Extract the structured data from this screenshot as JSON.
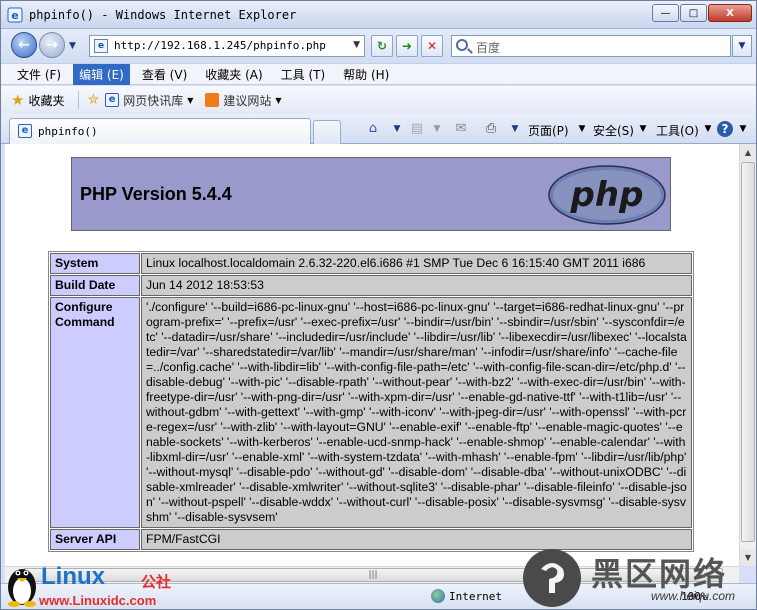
{
  "window": {
    "title": "phpinfo() - Windows Internet Explorer",
    "buttons": {
      "minimize": "—",
      "maximize": "□",
      "close": "X"
    }
  },
  "toolbar": {
    "url": "http://192.168.1.245/phpinfo.php",
    "search_placeholder": "百度"
  },
  "menu": {
    "items": [
      {
        "label": "文件 (F)"
      },
      {
        "label": "编辑 (E)",
        "active": true
      },
      {
        "label": "查看 (V)"
      },
      {
        "label": "收藏夹 (A)"
      },
      {
        "label": "工具 (T)"
      },
      {
        "label": "帮助 (H)"
      }
    ]
  },
  "favorites_bar": {
    "favorites_label": "收藏夹",
    "links": [
      {
        "label": "网页快讯库"
      },
      {
        "label": "建议网站"
      }
    ]
  },
  "tab": {
    "title": "phpinfo()"
  },
  "command_bar": {
    "page": "页面(P)",
    "safety": "安全(S)",
    "tools": "工具(O)"
  },
  "php": {
    "version_title": "PHP Version 5.4.4",
    "logo_text": "php",
    "rows": [
      {
        "key": "System",
        "value": "Linux localhost.localdomain 2.6.32-220.el6.i686 #1 SMP Tue Dec 6 16:15:40 GMT 2011 i686"
      },
      {
        "key": "Build Date",
        "value": "Jun 14 2012 18:53:53"
      },
      {
        "key": "Configure Command",
        "value": "'./configure' '--build=i686-pc-linux-gnu' '--host=i686-pc-linux-gnu' '--target=i686-redhat-linux-gnu' '--program-prefix=' '--prefix=/usr' '--exec-prefix=/usr' '--bindir=/usr/bin' '--sbindir=/usr/sbin' '--sysconfdir=/etc' '--datadir=/usr/share' '--includedir=/usr/include' '--libdir=/usr/lib' '--libexecdir=/usr/libexec' '--localstatedir=/var' '--sharedstatedir=/var/lib' '--mandir=/usr/share/man' '--infodir=/usr/share/info' '--cache-file=../config.cache' '--with-libdir=lib' '--with-config-file-path=/etc' '--with-config-file-scan-dir=/etc/php.d' '--disable-debug' '--with-pic' '--disable-rpath' '--without-pear' '--with-bz2' '--with-exec-dir=/usr/bin' '--with-freetype-dir=/usr' '--with-png-dir=/usr' '--with-xpm-dir=/usr' '--enable-gd-native-ttf' '--with-t1lib=/usr' '--without-gdbm' '--with-gettext' '--with-gmp' '--with-iconv' '--with-jpeg-dir=/usr' '--with-openssl' '--with-pcre-regex=/usr' '--with-zlib' '--with-layout=GNU' '--enable-exif' '--enable-ftp' '--enable-magic-quotes' '--enable-sockets' '--with-kerberos' '--enable-ucd-snmp-hack' '--enable-shmop' '--enable-calendar' '--with-libxml-dir=/usr' '--enable-xml' '--with-system-tzdata' '--with-mhash' '--enable-fpm' '--libdir=/usr/lib/php' '--without-mysql' '--disable-pdo' '--without-gd' '--disable-dom' '--disable-dba' '--without-unixODBC' '--disable-xmlreader' '--disable-xmlwriter' '--without-sqlite3' '--disable-phar' '--disable-fileinfo' '--disable-json' '--without-pspell' '--disable-wddx' '--without-curl' '--disable-posix' '--disable-sysvmsg' '--disable-sysvshm' '--disable-sysvsem'"
      },
      {
        "key": "Server API",
        "value": "FPM/FastCGI"
      }
    ]
  },
  "statusbar": {
    "zone": "Internet",
    "zoom": "100%"
  },
  "watermarks": {
    "linux_logo": "Linux",
    "linux_cn": "公社",
    "linux_site": "www.Linuxidc.com",
    "right_brand": "黑区网络",
    "right_site": "www.heiqu.com"
  }
}
